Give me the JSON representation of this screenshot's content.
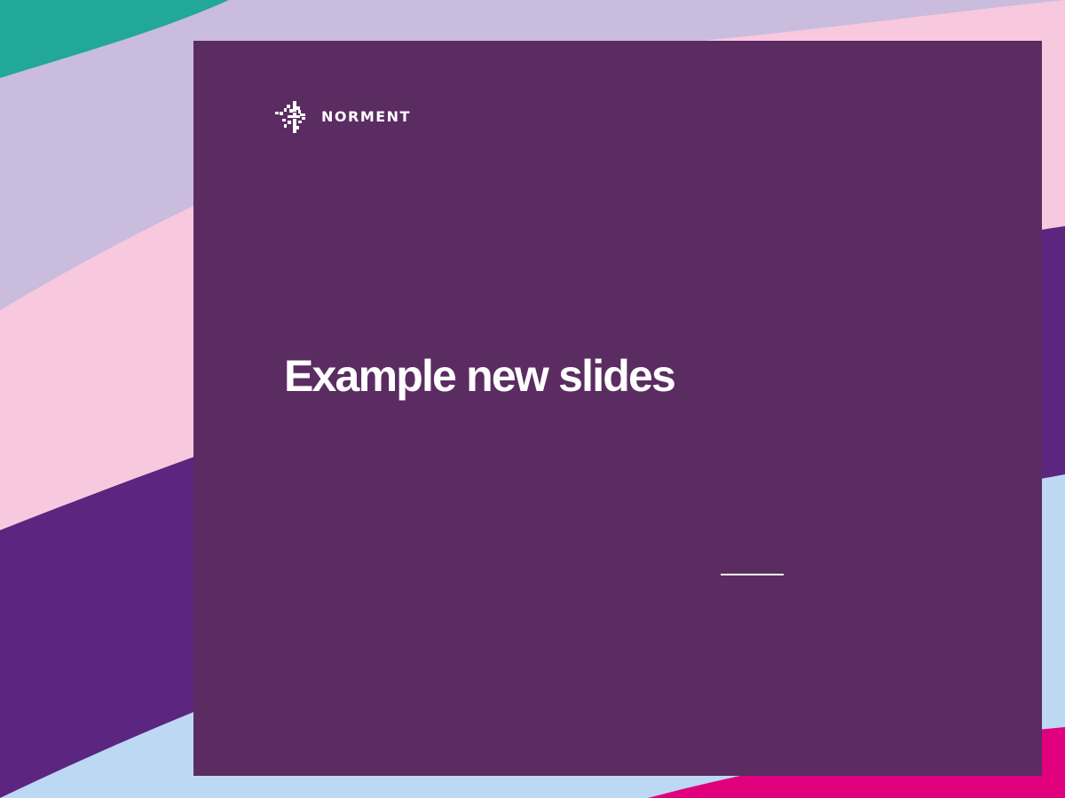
{
  "slide": {
    "title": "Example new slides",
    "brand": {
      "name": "NORMENT",
      "logo_icon": "norment-logo-icon"
    }
  },
  "colors": {
    "panel": "#5b2c61",
    "text": "#ffffff",
    "wave_teal": "#21a896",
    "wave_lavender": "#c9bcdd",
    "wave_pink": "#f8c8df",
    "wave_purple": "#5c2580",
    "wave_light_blue": "#bcd8f2",
    "wave_magenta": "#e0007d"
  }
}
